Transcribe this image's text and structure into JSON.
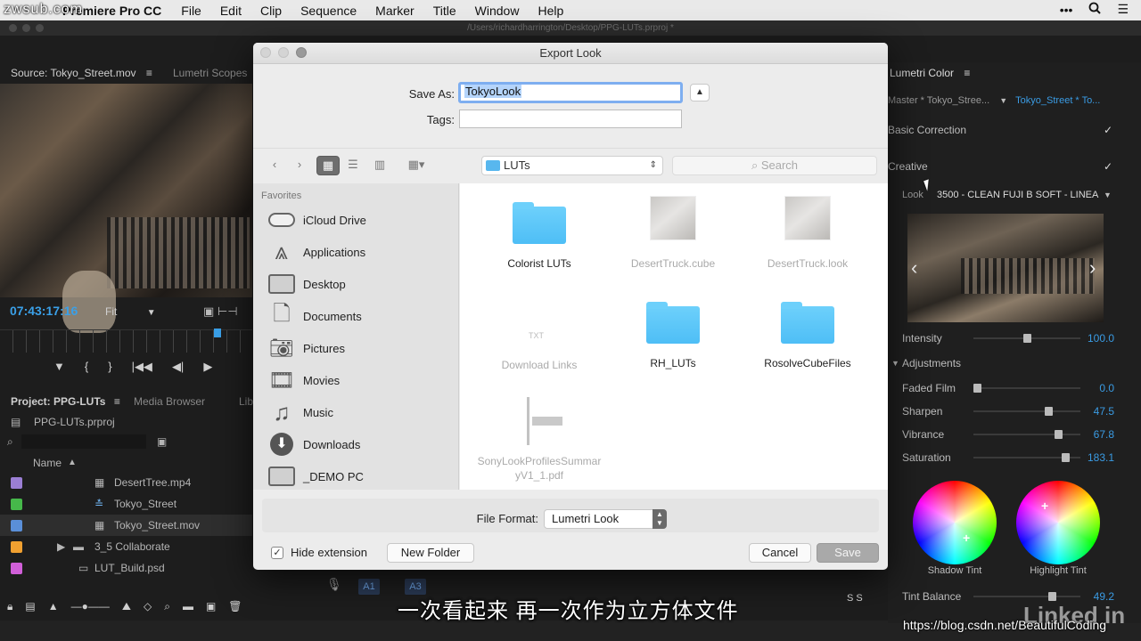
{
  "overlay": {
    "watermark_top": "zwsub.com",
    "subtitle": "一次看起来  再一次作为立方体文件",
    "csdn": "https://blog.csdn.net/BeautifulCoding",
    "linkedin": "Linked in"
  },
  "menubar": {
    "app": "Premiere Pro CC",
    "items": [
      "File",
      "Edit",
      "Clip",
      "Sequence",
      "Marker",
      "Title",
      "Window",
      "Help"
    ]
  },
  "window": {
    "title": "/Users/richardharrington/Desktop/PPG-LUTs.prproj *"
  },
  "source": {
    "tab": "Source: Tokyo_Street.mov",
    "tab2": "Lumetri Scopes",
    "timecode": "07:43:17:16",
    "fit": "Fit"
  },
  "project": {
    "tab": "Project: PPG-LUTs",
    "tab2": "Media Browser",
    "tab3": "Lib",
    "file": "PPG-LUTs.prproj",
    "col_name": "Name",
    "items": [
      {
        "name": "DesertTree.mp4",
        "color": "#9b7fd4"
      },
      {
        "name": "Tokyo_Street",
        "color": "#46b84a"
      },
      {
        "name": "Tokyo_Street.mov",
        "color": "#5a8fd8"
      },
      {
        "name": "3_5 Collaborate",
        "color": "#f0a030"
      },
      {
        "name": "LUT_Build.psd",
        "color": "#d05fd8"
      }
    ]
  },
  "dialog": {
    "title": "Export Look",
    "save_as_label": "Save As:",
    "save_as_value": "TokyoLook",
    "tags_label": "Tags:",
    "location": "LUTs",
    "search_placeholder": "Search",
    "favorites_label": "Favorites",
    "favorites": [
      "iCloud Drive",
      "Applications",
      "Desktop",
      "Documents",
      "Pictures",
      "Movies",
      "Music",
      "Downloads",
      "_DEMO PC"
    ],
    "files": [
      {
        "name": "Colorist LUTs",
        "kind": "folder"
      },
      {
        "name": "DesertTruck.cube",
        "kind": "thumb-dim"
      },
      {
        "name": "DesertTruck.look",
        "kind": "thumb-dim"
      },
      {
        "name": "Download Links",
        "kind": "txt-dim"
      },
      {
        "name": "RH_LUTs",
        "kind": "folder"
      },
      {
        "name": "RosolveCubeFiles",
        "kind": "folder"
      },
      {
        "name": "SonyLookProfilesSummaryV1_1.pdf",
        "kind": "pdf-dim"
      }
    ],
    "file_format_label": "File Format:",
    "file_format_value": "Lumetri Look",
    "hide_extension": "Hide extension",
    "new_folder": "New Folder",
    "cancel": "Cancel",
    "save": "Save"
  },
  "lumetri": {
    "title": "Lumetri Color",
    "master": "Master * Tokyo_Stree...",
    "clip": "Tokyo_Street * To...",
    "basic": "Basic Correction",
    "creative": "Creative",
    "look_label": "Look",
    "look_value": "3500 - CLEAN FUJI B SOFT - LINEA",
    "intensity_label": "Intensity",
    "intensity_value": "100.0",
    "adjustments": "Adjustments",
    "sliders": [
      {
        "label": "Faded Film",
        "value": "0.0",
        "pos": 0
      },
      {
        "label": "Sharpen",
        "value": "47.5",
        "pos": 0.72
      },
      {
        "label": "Vibrance",
        "value": "67.8",
        "pos": 0.82
      },
      {
        "label": "Saturation",
        "value": "183.1",
        "pos": 0.89
      }
    ],
    "intensity_pos": 0.5,
    "shadow_tint": "Shadow Tint",
    "highlight_tint": "Highlight Tint",
    "tint_balance_label": "Tint Balance",
    "tint_balance_value": "49.2"
  }
}
